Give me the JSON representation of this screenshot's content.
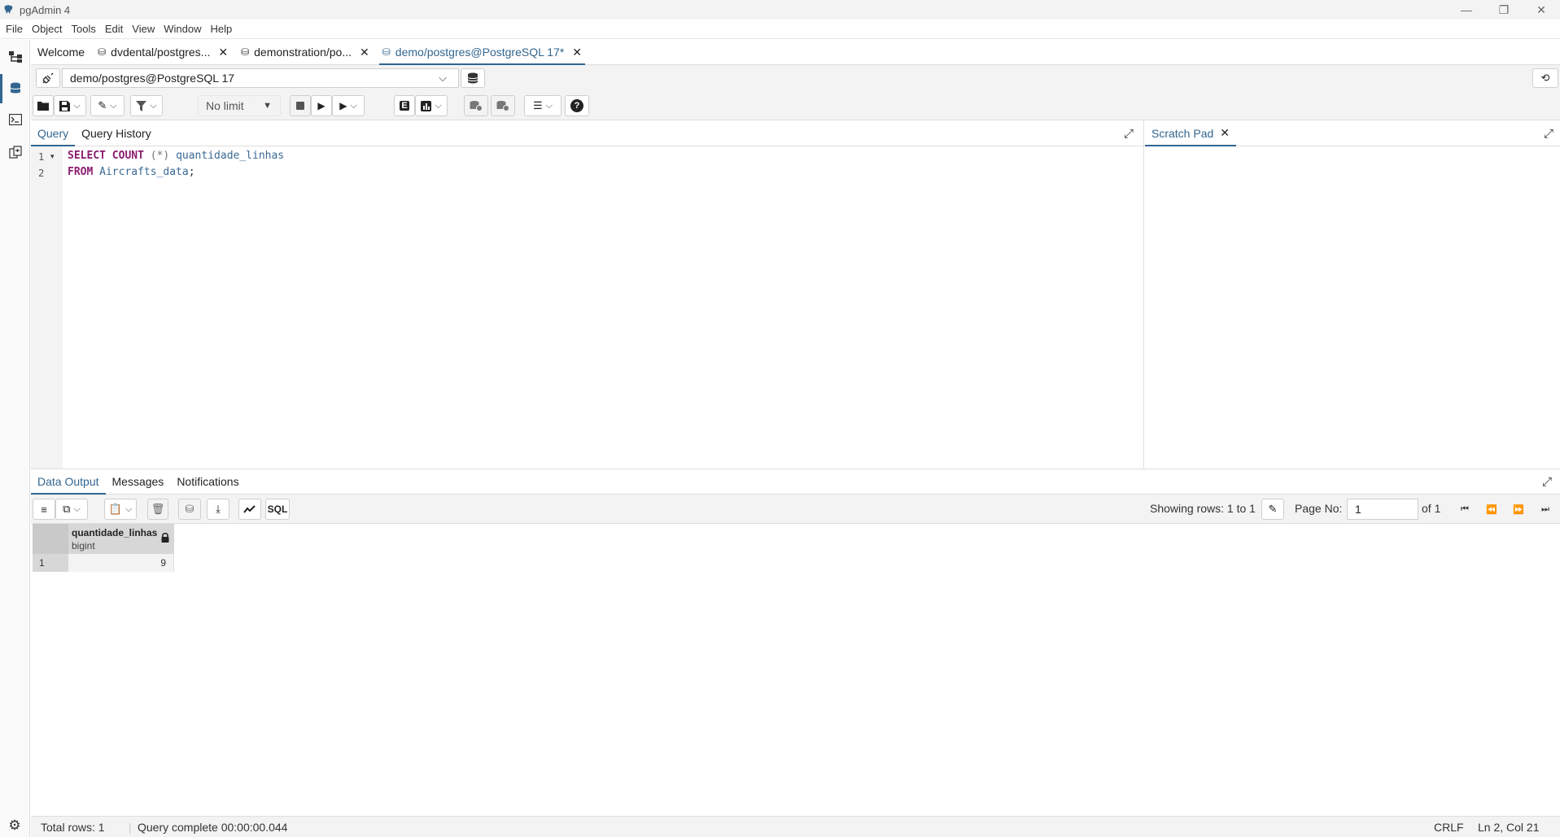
{
  "window": {
    "title": "pgAdmin 4",
    "minimize_glyph": "—",
    "maximize_glyph": "❐",
    "close_glyph": "✕"
  },
  "menu": [
    "File",
    "Object",
    "Tools",
    "Edit",
    "View",
    "Window",
    "Help"
  ],
  "tabs": [
    {
      "label": "Welcome",
      "closable": false,
      "active": false
    },
    {
      "label": "dvdental/postgres...",
      "closable": true,
      "active": false
    },
    {
      "label": "demonstration/po...",
      "closable": true,
      "active": false
    },
    {
      "label": "demo/postgres@PostgreSQL 17*",
      "closable": true,
      "active": true
    }
  ],
  "connection": {
    "selected": "demo/postgres@PostgreSQL 17"
  },
  "toolbar": {
    "row_limit": "No limit"
  },
  "editor": {
    "tabs": [
      "Query",
      "Query History"
    ],
    "line_numbers": [
      "1",
      "2"
    ],
    "lines": [
      [
        {
          "t": "SELECT",
          "c": "kw"
        },
        {
          "t": " "
        },
        {
          "t": "COUNT",
          "c": "kw"
        },
        {
          "t": " "
        },
        {
          "t": "(*)",
          "c": "op"
        },
        {
          "t": " "
        },
        {
          "t": "quantidade_linhas",
          "c": "ident"
        }
      ],
      [
        {
          "t": "FROM",
          "c": "kw"
        },
        {
          "t": " "
        },
        {
          "t": "Aircrafts_data",
          "c": "ident"
        },
        {
          "t": ";",
          "c": "punct"
        }
      ]
    ]
  },
  "scratch_pad": {
    "label": "Scratch Pad"
  },
  "results": {
    "tabs": [
      "Data Output",
      "Messages",
      "Notifications"
    ],
    "sql_label": "SQL",
    "rows_info": "Showing rows: 1 to 1",
    "page_label": "Page No:",
    "page_value": "1",
    "of_label": "of 1",
    "columns": [
      {
        "name": "quantidade_linhas",
        "type": "bigint"
      }
    ],
    "rows": [
      {
        "num": "1",
        "values": [
          "9"
        ]
      }
    ]
  },
  "status": {
    "total_rows": "Total rows: 1",
    "query_status": "Query complete 00:00:00.044",
    "line_ending": "CRLF",
    "cursor": "Ln 2, Col 21"
  },
  "colors": {
    "accent": "#326690",
    "keyword": "#8b1d6f",
    "identifier": "#3a6a96"
  }
}
